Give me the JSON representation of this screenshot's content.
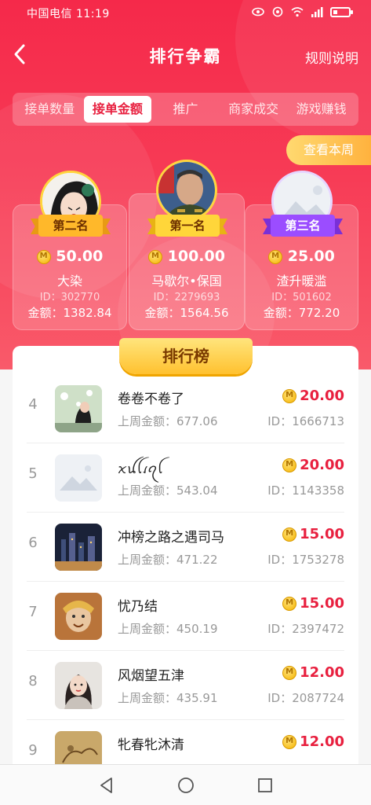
{
  "status_bar": {
    "left_text": "中国电信 11:19"
  },
  "nav": {
    "title": "排行争霸",
    "rules": "规则说明"
  },
  "tabs": [
    {
      "label": "接单数量"
    },
    {
      "label": "接单金额"
    },
    {
      "label": "推广"
    },
    {
      "label": "商家成交"
    },
    {
      "label": "游戏赚钱"
    }
  ],
  "active_tab": "接单金额",
  "view_week": "查看本周",
  "podium": {
    "second": {
      "rank_label": "第二名",
      "amount": "50.00",
      "name": "大染",
      "id": "ID：302770",
      "money": "金额：1382.84"
    },
    "first": {
      "rank_label": "第一名",
      "amount": "100.00",
      "name": "马歇尔•保国",
      "id": "ID：2279693",
      "money": "金额：1564.56"
    },
    "third": {
      "rank_label": "第三名",
      "amount": "25.00",
      "name": "渣升暖滥",
      "id": "ID：501602",
      "money": "金额：772.20"
    }
  },
  "board": {
    "title": "排行榜",
    "rows": [
      {
        "rank": "4",
        "name": "卷卷不卷了",
        "last_week": "上周金额：677.06",
        "amount": "20.00",
        "id": "ID：1666713"
      },
      {
        "rank": "5",
        "name": "ꪎꪊꪶꪹꪖꪶ",
        "last_week": "上周金额：543.04",
        "amount": "20.00",
        "id": "ID：1143358"
      },
      {
        "rank": "6",
        "name": "冲榜之路之遇司马",
        "last_week": "上周金额：471.22",
        "amount": "15.00",
        "id": "ID：1753278"
      },
      {
        "rank": "7",
        "name": "忧乃结",
        "last_week": "上周金额：450.19",
        "amount": "15.00",
        "id": "ID：2397472"
      },
      {
        "rank": "8",
        "name": "风烟望五津",
        "last_week": "上周金额：435.91",
        "amount": "12.00",
        "id": "ID：2087724"
      },
      {
        "rank": "9",
        "name": "牝春牝沐清",
        "last_week": "",
        "amount": "12.00",
        "id": ""
      }
    ]
  },
  "colors": {
    "brand_red": "#f5294a",
    "amount_red": "#e8203f",
    "gold": "#ffc12f",
    "silver_ribbon": "#9b4dff"
  }
}
